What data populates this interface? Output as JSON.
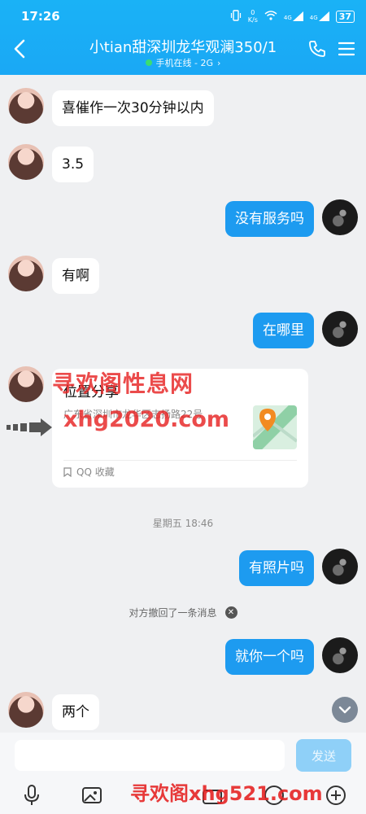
{
  "status_bar": {
    "time": "17:26",
    "net_speed_value": "0",
    "net_speed_unit": "K/s",
    "signal1": "4G",
    "signal2": "4G",
    "battery": "37"
  },
  "header": {
    "title": "小tian甜深圳龙华观澜350/1",
    "subtitle": "手机在线 - 2G"
  },
  "messages": [
    {
      "side": "left",
      "text": "喜催作一次30分钟以内"
    },
    {
      "side": "left",
      "text": "3.5"
    },
    {
      "side": "right",
      "text": "没有服务吗"
    },
    {
      "side": "left",
      "text": "有啊"
    },
    {
      "side": "right",
      "text": "在哪里"
    },
    {
      "side": "right",
      "text": "有照片吗"
    },
    {
      "side": "right",
      "text": "就你一个吗"
    },
    {
      "side": "left",
      "text": "两个"
    }
  ],
  "location_card": {
    "title": "位置分享",
    "address": "广东省深圳市龙华区志扬路22号",
    "footer": "QQ 收藏"
  },
  "time_separator": "星期五 18:46",
  "recall_notice": "对方撤回了一条消息",
  "input": {
    "placeholder": "",
    "send_label": "发送"
  },
  "watermarks": {
    "line1": "寻欢阁性息网",
    "line2": "xhg2020.com",
    "line3": "寻欢阁xhg521.com"
  },
  "colors": {
    "header_bg": "#1aabf5",
    "bubble_right": "#1d9bf0",
    "bubble_left": "#ffffff",
    "chat_bg": "#eff0f2"
  }
}
